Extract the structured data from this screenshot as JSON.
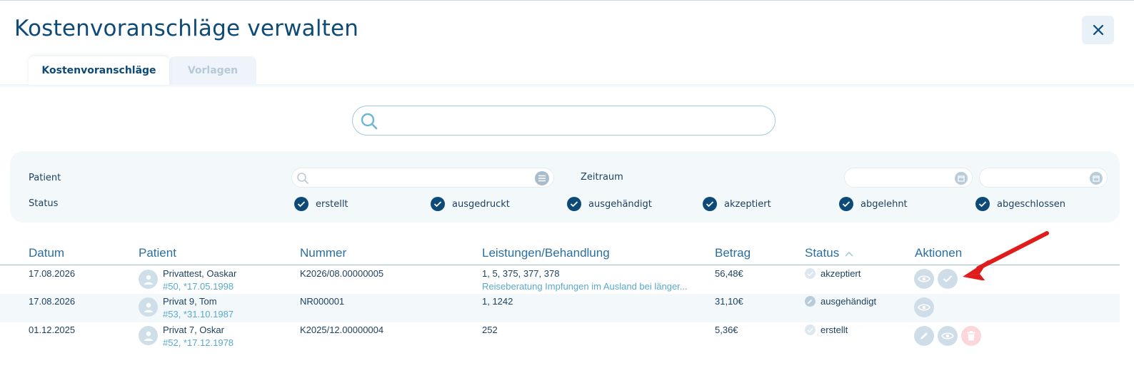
{
  "window": {
    "title": "Kostenvoranschläge verwalten",
    "close_icon": "close-icon"
  },
  "tabs": [
    {
      "label": "Kostenvoranschläge",
      "active": true
    },
    {
      "label": "Vorlagen",
      "active": false
    }
  ],
  "search": {
    "placeholder": "",
    "value": ""
  },
  "filters": {
    "patient_label": "Patient",
    "zeitraum_label": "Zeitraum",
    "status_label": "Status",
    "statuses": [
      {
        "label": "erstellt",
        "checked": true
      },
      {
        "label": "ausgedruckt",
        "checked": true
      },
      {
        "label": "ausgehändigt",
        "checked": true
      },
      {
        "label": "akzeptiert",
        "checked": true
      },
      {
        "label": "abgelehnt",
        "checked": true
      },
      {
        "label": "abgeschlossen",
        "checked": true
      }
    ]
  },
  "table": {
    "columns": [
      "Datum",
      "Patient",
      "Nummer",
      "Leistungen/Behandlung",
      "Betrag",
      "Status",
      "Aktionen"
    ],
    "sort_column": "Status",
    "sort_direction": "ascending",
    "rows": [
      {
        "datum": "17.08.2026",
        "patient_name": "Privattest, Oaskar",
        "patient_sub": "#50, *17.05.1998",
        "nummer": "K2026/08.00000005",
        "leistungen": "1, 5, 375, 377, 378",
        "leistungen_sub": "Reiseberatung Impfungen im Ausland bei länger...",
        "betrag": "56,48€",
        "status": "akzeptiert",
        "actions": [
          "view",
          "accept"
        ]
      },
      {
        "datum": "17.08.2026",
        "patient_name": "Privat 9, Tom",
        "patient_sub": "#53, *31.10.1987",
        "nummer": "NR000001",
        "leistungen": "1, 1242",
        "leistungen_sub": "",
        "betrag": "31,10€",
        "status": "ausgehändigt",
        "actions": [
          "view"
        ]
      },
      {
        "datum": "01.12.2025",
        "patient_name": "Privat 7, Oskar",
        "patient_sub": "#52, *17.12.1978",
        "nummer": "K2025/12.00000004",
        "leistungen": "252",
        "leistungen_sub": "",
        "betrag": "5,36€",
        "status": "erstellt",
        "actions": [
          "edit",
          "view",
          "delete"
        ]
      }
    ]
  },
  "colors": {
    "primary": "#0d4a78",
    "accent": "#5aa9cc",
    "annotation_arrow": "#e01b1b",
    "delete": "#fbd7da"
  }
}
